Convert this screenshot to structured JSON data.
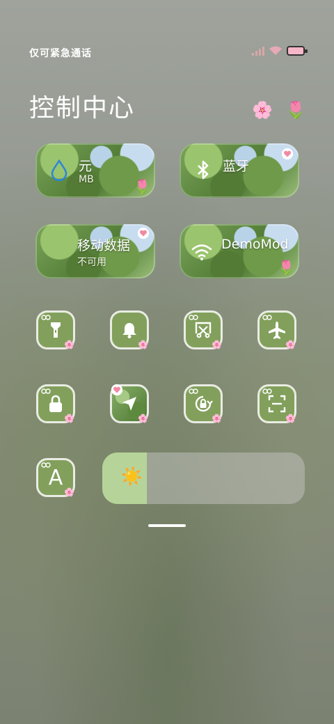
{
  "status": {
    "carrier": "仅可紧急通话"
  },
  "page_title": "控制中心",
  "decor": {
    "flower1": "🌸",
    "flower2": "🌷"
  },
  "cards": {
    "data_usage": {
      "label": "元",
      "sub": "MB",
      "icon": "water-drop-icon",
      "flower": "🌷"
    },
    "bluetooth": {
      "label": "蓝牙",
      "sub": "",
      "icon": "bluetooth-icon"
    },
    "mobile_data": {
      "label": "移动数据",
      "sub": "不可用",
      "icon": "mobile-data-icon"
    },
    "wifi": {
      "label": "DemoMod",
      "sub": "",
      "icon": "wifi-icon",
      "flower": "🌷"
    }
  },
  "tiles": [
    {
      "name": "flashlight",
      "icon": "flashlight-icon"
    },
    {
      "name": "bell",
      "icon": "bell-icon"
    },
    {
      "name": "screen-cast",
      "icon": "screen-cast-icon"
    },
    {
      "name": "airplane",
      "icon": "airplane-icon"
    },
    {
      "name": "lock",
      "icon": "lock-icon"
    },
    {
      "name": "location",
      "icon": "location-icon"
    },
    {
      "name": "auto-rotate",
      "icon": "rotation-lock-icon"
    },
    {
      "name": "scan",
      "icon": "scan-icon"
    },
    {
      "name": "font",
      "icon": "font-icon",
      "letter": "A"
    }
  ],
  "brightness": {
    "level": 0.22,
    "icon": "sun-icon",
    "glyph": "☀️"
  },
  "colors": {
    "accent": "#82a05c",
    "slider_fill": "#b6d49a",
    "flower_pink": "#f4b6c8"
  }
}
